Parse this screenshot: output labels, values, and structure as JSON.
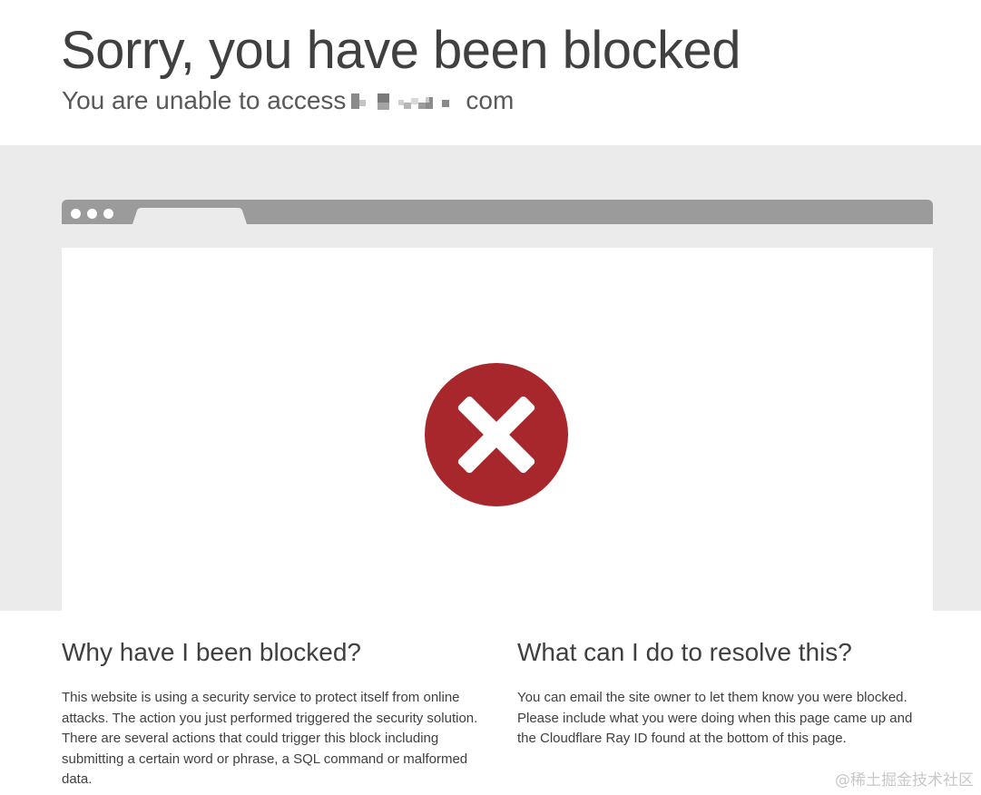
{
  "header": {
    "title": "Sorry, you have been blocked",
    "subtitle_prefix": "You are unable to access",
    "domain_suffix": "com"
  },
  "illustration": {
    "window_controls": [
      "dot",
      "dot",
      "dot"
    ],
    "icon": "error-x-icon",
    "icon_color": "#a8272d"
  },
  "why_blocked": {
    "heading": "Why have I been blocked?",
    "body": "This website is using a security service to protect itself from online attacks. The action you just performed triggered the security solution. There are several actions that could trigger this block including submitting a certain word or phrase, a SQL command or malformed data."
  },
  "resolve": {
    "heading": "What can I do to resolve this?",
    "body": "You can email the site owner to let them know you were blocked. Please include what you were doing when this page came up and the Cloudflare Ray ID found at the bottom of this page."
  },
  "watermark": "@稀土掘金技术社区"
}
